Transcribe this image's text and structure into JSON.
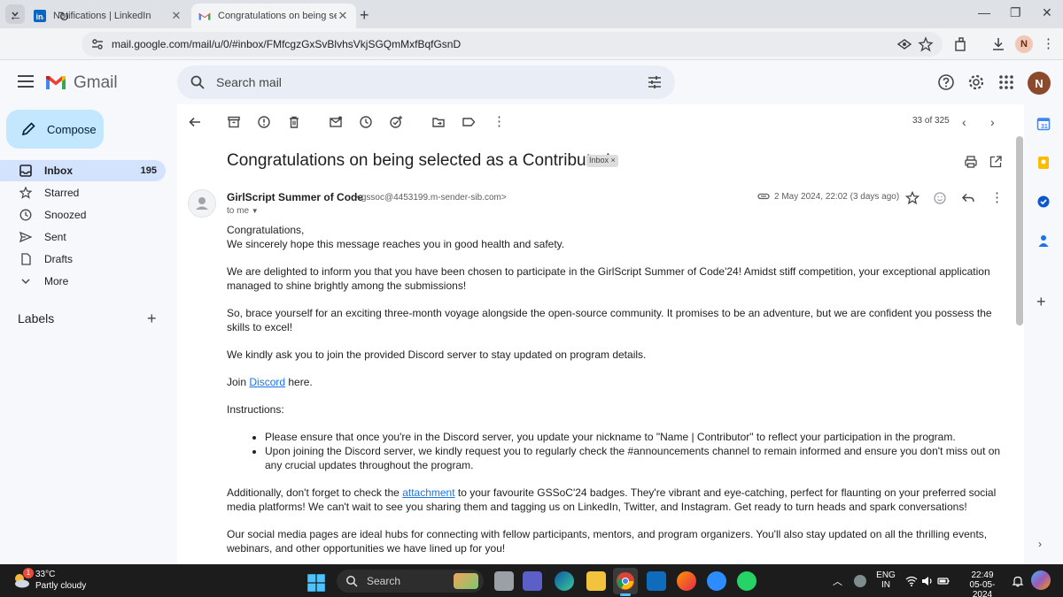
{
  "browser": {
    "tabs": [
      {
        "title": "Notifications | LinkedIn",
        "favicon": "linkedin-icon"
      },
      {
        "title": "Congratulations on being selected as a Contributor!",
        "favicon": "gmail-icon"
      }
    ],
    "url": "mail.google.com/mail/u/0/#inbox/FMfcgzGxSvBlvhsVkjSGQmMxfBqfGsnD",
    "profile_initial": "N"
  },
  "gmail": {
    "logo_text": "Gmail",
    "search_placeholder": "Search mail",
    "avatar_initial": "N",
    "compose_label": "Compose",
    "nav": [
      {
        "label": "Inbox",
        "count": "195",
        "icon": "inbox-icon"
      },
      {
        "label": "Starred",
        "count": "",
        "icon": "star-icon"
      },
      {
        "label": "Snoozed",
        "count": "",
        "icon": "clock-icon"
      },
      {
        "label": "Sent",
        "count": "",
        "icon": "send-icon"
      },
      {
        "label": "Drafts",
        "count": "",
        "icon": "draft-icon"
      },
      {
        "label": "More",
        "count": "",
        "icon": "chevron-down-icon"
      }
    ],
    "labels_heading": "Labels",
    "pager": "33 of 325"
  },
  "email": {
    "subject": "Congratulations on being selected as a Contributor!",
    "chip": "Inbox",
    "sender_name": "GirlScript Summer of Code",
    "sender_email": "<gssoc@4453199.m-sender-sib.com>",
    "to": "to me",
    "date": "2 May 2024, 22:02 (3 days ago)",
    "greeting": "Congratulations,",
    "line1": "We sincerely hope this message reaches you in good health and safety.",
    "p2": "We are delighted to inform you that you have been chosen to participate in the GirlScript Summer of Code'24! Amidst stiff competition, your exceptional application managed to shine brightly among the submissions!",
    "p3": "So, brace yourself for an exciting three-month voyage alongside the open-source community. It promises to be an adventure, but we are confident you possess the skills to excel!",
    "p4": "We kindly ask you to join the provided Discord server to stay updated on program details.",
    "join_prefix": "Join ",
    "join_link": "Discord",
    "join_suffix": " here.",
    "instructions_heading": "Instructions:",
    "instructions": [
      "Please ensure that once you're in the Discord server, you update your nickname to \"Name | Contributor\" to reflect your participation in the program.",
      "Upon joining the Discord server, we kindly request you to regularly check the #announcements channel to remain informed and ensure you don't miss out on any crucial updates throughout the program."
    ],
    "p6_prefix": "Additionally, don't forget to check the ",
    "p6_link": "attachment",
    "p6_suffix": " to your favourite GSSoC'24 badges. They're vibrant and eye-catching, perfect for flaunting on your preferred social media platforms! We can't wait to see you sharing them and tagging us on LinkedIn, Twitter, and Instagram. Get ready to turn heads and spark conversations!",
    "p7": "Our social media pages are ideal hubs for connecting with fellow participants, mentors, and program organizers. You'll also stay updated on all the thrilling events, webinars, and other opportunities we have lined up for you!"
  },
  "taskbar": {
    "weather_badge": "1",
    "temperature": "33°C",
    "weather": "Partly cloudy",
    "search_label": "Search",
    "lang1": "ENG",
    "lang2": "IN",
    "time": "22:49",
    "date": "05-05-2024"
  },
  "colors": {
    "accent": "#0b57d0",
    "compose_bg": "#c2e7ff",
    "active_nav_bg": "#d3e3fd",
    "page_bg": "#f6f8fc",
    "gmail_red": "#ea4335"
  }
}
